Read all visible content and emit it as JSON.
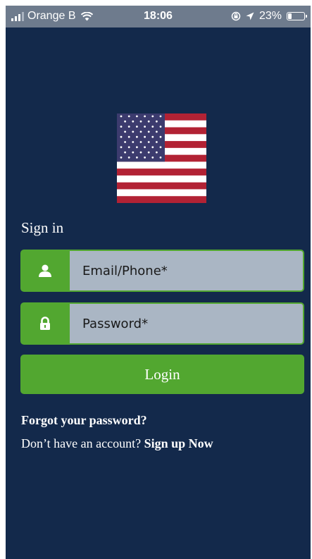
{
  "status_bar": {
    "carrier": "Orange B",
    "time": "18:06",
    "battery_percent": "23%",
    "battery_level": 0.23,
    "icons": [
      "signal-icon",
      "wifi-icon",
      "orientation-lock-icon",
      "location-arrow-icon",
      "battery-icon"
    ]
  },
  "logo": {
    "icon": "us-flag-icon"
  },
  "signin": {
    "title": "Sign in",
    "email": {
      "placeholder": "Email/Phone*",
      "value": "",
      "icon": "user-icon"
    },
    "password": {
      "placeholder": "Password*",
      "value": "",
      "icon": "lock-icon"
    },
    "login_label": "Login",
    "forgot_label": "Forgot your password?",
    "no_account_text": "Don’t have an account?",
    "signup_label": "Sign up Now"
  },
  "colors": {
    "background": "#13294b",
    "accent_green": "#52a730",
    "input_fill": "#aab6c4",
    "status_bar": "#6e7b8d"
  }
}
